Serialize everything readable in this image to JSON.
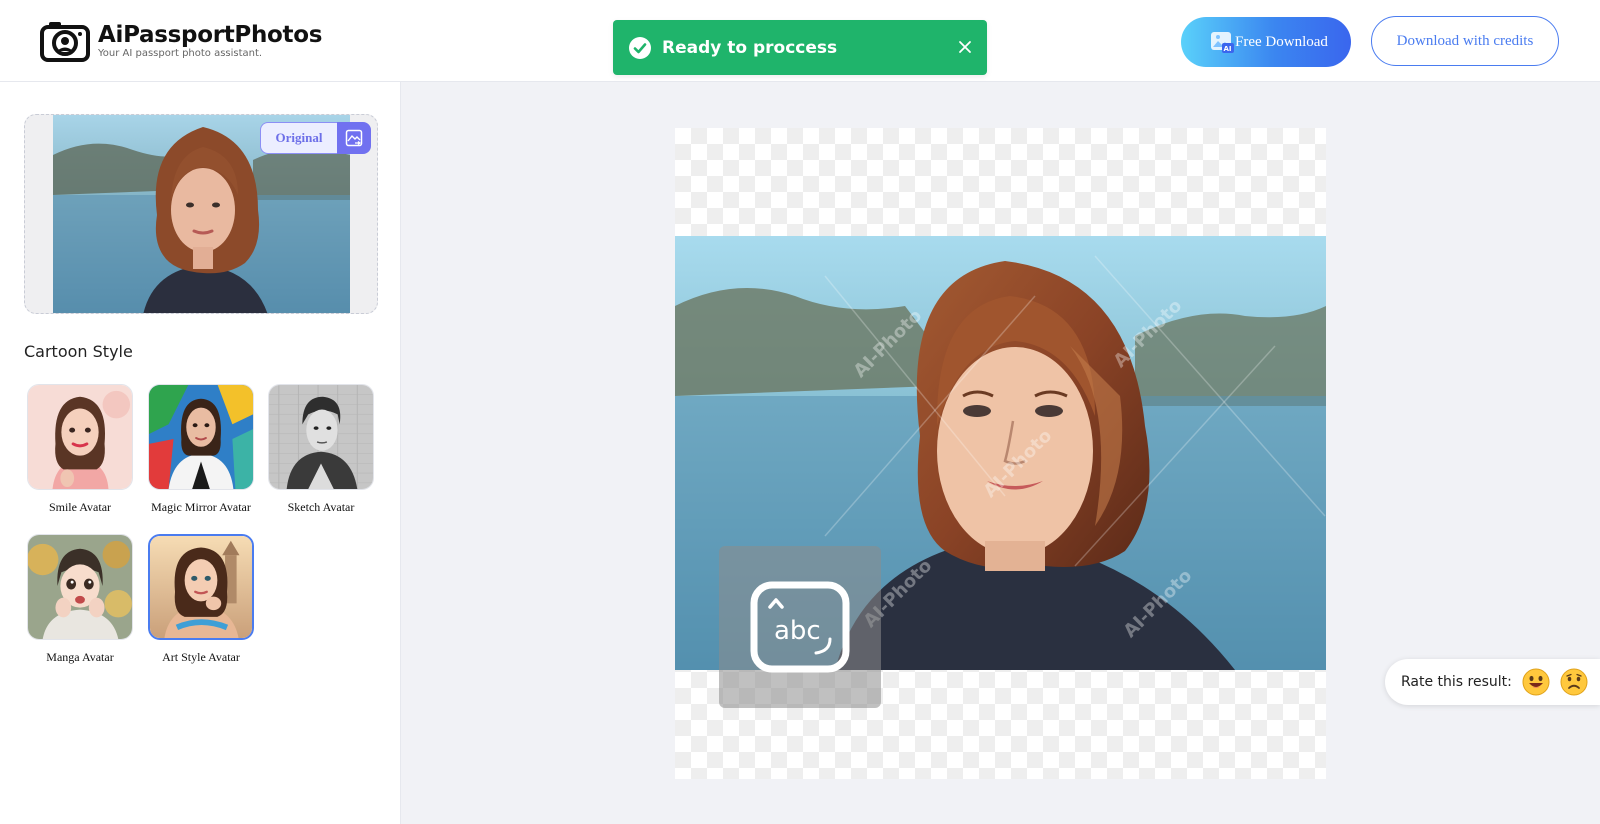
{
  "brand": {
    "title": "AiPassportPhotos",
    "subtitle": "Your AI passport photo assistant."
  },
  "toast": {
    "message": "Ready to proccess",
    "color": "#1fb46b"
  },
  "header": {
    "free_download_label": "Free Download",
    "download_credits_label": "Download with credits"
  },
  "original": {
    "toggle_label": "Original"
  },
  "cartoon": {
    "section_title": "Cartoon Style",
    "styles": [
      {
        "label": "Smile Avatar",
        "selected": false
      },
      {
        "label": "Magic Mirror Avatar",
        "selected": false
      },
      {
        "label": "Sketch Avatar",
        "selected": false
      },
      {
        "label": "Manga Avatar",
        "selected": false
      },
      {
        "label": "Art Style Avatar",
        "selected": true
      }
    ]
  },
  "preview": {
    "watermark": "AI-Photo",
    "ocr_text": "abc"
  },
  "rating": {
    "label": "Rate this result:",
    "icons": [
      "happy-face-icon",
      "sad-face-icon"
    ]
  },
  "colors": {
    "accent": "#4a7cf0",
    "toggle_purple": "#7171f0"
  }
}
